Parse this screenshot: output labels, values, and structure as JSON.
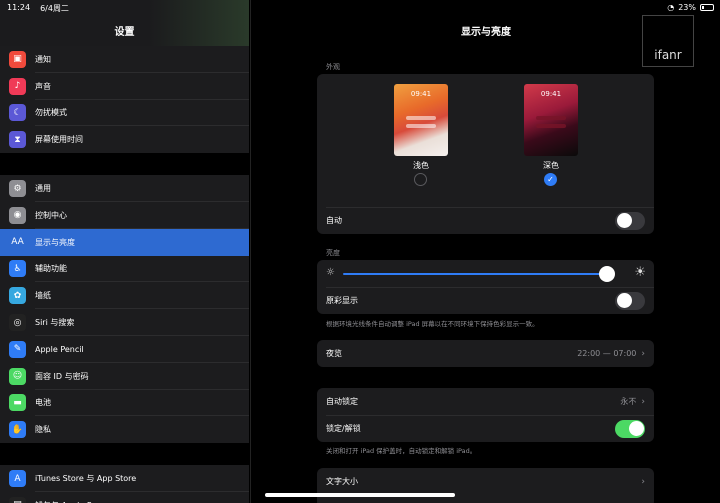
{
  "status": {
    "time": "11:24",
    "date": "6/4周二",
    "battery": "23%"
  },
  "sidebar": {
    "title": "设置",
    "groups": [
      [
        {
          "label": "通知",
          "icon": "notifications-icon",
          "color": "#f04a3c",
          "glyph": "▣"
        },
        {
          "label": "声音",
          "icon": "sound-icon",
          "color": "#f03a57",
          "glyph": "♪"
        },
        {
          "label": "勿扰模式",
          "icon": "moon-icon",
          "color": "#5b58d6",
          "glyph": "☾"
        },
        {
          "label": "屏幕使用时间",
          "icon": "hourglass-icon",
          "color": "#5b58d6",
          "glyph": "⧗"
        }
      ],
      [
        {
          "label": "通用",
          "icon": "gear-icon",
          "color": "#8e8e93",
          "glyph": "⚙"
        },
        {
          "label": "控制中心",
          "icon": "control-center-icon",
          "color": "#8e8e93",
          "glyph": "◉"
        },
        {
          "label": "显示与亮度",
          "icon": "display-icon",
          "color": "#2e6ad1",
          "glyph": "AA",
          "active": true
        },
        {
          "label": "辅助功能",
          "icon": "accessibility-icon",
          "color": "#2f7cf6",
          "glyph": "♿"
        },
        {
          "label": "墙纸",
          "icon": "wallpaper-icon",
          "color": "#36a8e0",
          "glyph": "✿"
        },
        {
          "label": "Siri 与搜索",
          "icon": "siri-icon",
          "color": "#222",
          "glyph": "◎"
        },
        {
          "label": "Apple Pencil",
          "icon": "pencil-icon",
          "color": "#2f7cf6",
          "glyph": "✎"
        },
        {
          "label": "面容 ID 与密码",
          "icon": "faceid-icon",
          "color": "#4cd964",
          "glyph": "☺"
        },
        {
          "label": "电池",
          "icon": "battery-icon",
          "color": "#4cd964",
          "glyph": "▬"
        },
        {
          "label": "隐私",
          "icon": "privacy-hand-icon",
          "color": "#2f7cf6",
          "glyph": "✋"
        }
      ],
      [
        {
          "label": "iTunes Store 与 App Store",
          "icon": "app-store-icon",
          "color": "#2f7cf6",
          "glyph": "A"
        },
        {
          "label": "钱包与 Apple Pay",
          "icon": "wallet-icon",
          "color": "#222",
          "glyph": "▤"
        }
      ]
    ]
  },
  "main": {
    "title": "显示与亮度",
    "watermark": "ifanr",
    "appearance": {
      "section": "外观",
      "thumb_time": "09:41",
      "light_label": "浅色",
      "dark_label": "深色",
      "selected": "dark",
      "auto_label": "自动",
      "auto_on": false
    },
    "brightness": {
      "section": "亮度",
      "level": 0.98,
      "true_tone_label": "原彩显示",
      "true_tone_on": false,
      "note": "根据环境光线条件自动调整 iPad 屏幕以在不同环境下保持色彩显示一致。"
    },
    "night_shift": {
      "label": "夜览",
      "value": "22:00 — 07:00"
    },
    "auto_lock": {
      "label": "自动锁定",
      "value": "永不"
    },
    "lock_unlock": {
      "label": "锁定/解锁",
      "on": true,
      "note": "关闭和打开 iPad 保护盖时，自动锁定和解锁 iPad。"
    },
    "text_size": {
      "label": "文字大小"
    }
  }
}
